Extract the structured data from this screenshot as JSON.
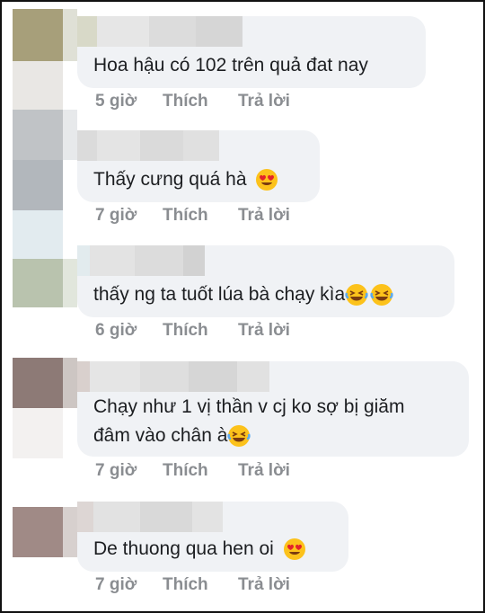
{
  "comments": [
    {
      "text": "Hoa hậu có 102 trên quả đat nay",
      "time": "5 giờ",
      "like": "Thích",
      "reply": "Trả lời"
    },
    {
      "text": "Thấy cưng quá hà",
      "time": "7 giờ",
      "like": "Thích",
      "reply": "Trả lời",
      "emoji": "heart-eyes"
    },
    {
      "text": "thấy ng ta tuốt lúa bà chạy kìa",
      "time": "6 giờ",
      "like": "Thích",
      "reply": "Trả lời",
      "emoji": "laughing-tears"
    },
    {
      "text_line1": "Chạy như 1 vị thần v cj ko sợ bị giăm",
      "text_line2": "đâm vào chân à",
      "time": "7 giờ",
      "like": "Thích",
      "reply": "Trả lời",
      "emoji": "laughing-tears"
    },
    {
      "text": "De thuong qua hen oi",
      "time": "7 giờ",
      "like": "Thích",
      "reply": "Trả lời",
      "emoji": "heart-eyes"
    }
  ],
  "colors": {
    "bubble": "#f0f2f5",
    "text": "#1c1e21",
    "meta": "#8a8d91"
  }
}
